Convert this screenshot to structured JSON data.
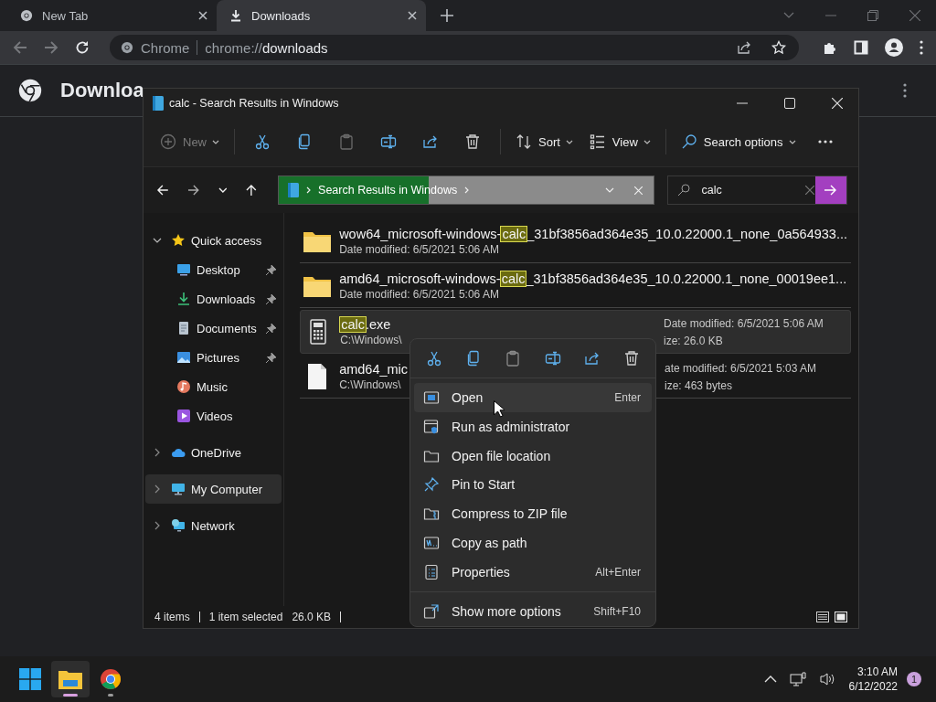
{
  "browser": {
    "tabs": [
      {
        "label": "New Tab",
        "selected": false
      },
      {
        "label": "Downloads",
        "selected": true
      }
    ],
    "omnibox": {
      "chip": "Chrome",
      "url_scheme": "chrome://",
      "url_path": "downloads"
    },
    "page": {
      "title": "Downloa"
    }
  },
  "explorer": {
    "title": "calc - Search Results in Windows",
    "toolbar": [
      {
        "kind": "new",
        "label": "New",
        "disabled": true
      },
      {
        "kind": "cut",
        "disabled": false
      },
      {
        "kind": "copy",
        "disabled": false
      },
      {
        "kind": "paste",
        "disabled": true
      },
      {
        "kind": "rename",
        "disabled": false
      },
      {
        "kind": "share",
        "disabled": false
      },
      {
        "kind": "delete",
        "disabled": false
      },
      {
        "kind": "sort",
        "label": "Sort",
        "disabled": false
      },
      {
        "kind": "view",
        "label": "View",
        "disabled": false
      },
      {
        "kind": "search-options",
        "label": "Search options",
        "disabled": false
      },
      {
        "kind": "more",
        "disabled": false
      }
    ],
    "address": {
      "crumb": "Search Results in Windows",
      "level": 0.4
    },
    "search": {
      "value": "calc"
    },
    "sidebar": [
      {
        "label": "Quick access",
        "kind": "star",
        "expanded": true,
        "selected": false,
        "children": [
          {
            "label": "Desktop",
            "kind": "desktop",
            "pinned": true,
            "selected": false
          },
          {
            "label": "Downloads",
            "kind": "download",
            "pinned": true,
            "selected": false
          },
          {
            "label": "Documents",
            "kind": "document",
            "pinned": true,
            "selected": false
          },
          {
            "label": "Pictures",
            "kind": "picture",
            "pinned": true,
            "selected": false
          },
          {
            "label": "Music",
            "kind": "music",
            "pinned": false,
            "selected": false
          },
          {
            "label": "Videos",
            "kind": "video",
            "pinned": false,
            "selected": false
          }
        ]
      },
      {
        "label": "OneDrive",
        "kind": "cloud",
        "expanded": false,
        "selected": false
      },
      {
        "label": "My Computer",
        "kind": "computer",
        "expanded": false,
        "selected": true
      },
      {
        "label": "Network",
        "kind": "network",
        "expanded": false,
        "selected": false
      }
    ],
    "results": [
      {
        "kind": "folder",
        "selected": false,
        "name": [
          {
            "text": "wow64_microsoft-windows-",
            "match": false
          },
          {
            "text": "calc",
            "match": true
          },
          {
            "text": "_31bf3856ad364e35_10.0.22000.1_none_0a564933...",
            "match": false
          }
        ],
        "detail": "Date modified: 6/5/2021 5:06 AM"
      },
      {
        "kind": "folder",
        "selected": false,
        "name": [
          {
            "text": "amd64_microsoft-windows-",
            "match": false
          },
          {
            "text": "calc",
            "match": true
          },
          {
            "text": "_31bf3856ad364e35_10.0.22000.1_none_00019ee1...",
            "match": false
          }
        ],
        "detail": "Date modified: 6/5/2021 5:06 AM"
      },
      {
        "kind": "app",
        "selected": true,
        "name": [
          {
            "text": "calc",
            "match": true
          },
          {
            "text": ".exe",
            "match": false
          }
        ],
        "detail": "C:\\Windows\\",
        "side": [
          "Date modified: 6/5/2021 5:06 AM",
          "ize: 26.0 KB"
        ]
      },
      {
        "kind": "file",
        "selected": false,
        "name": [
          {
            "text": "amd64_mic",
            "match": false
          }
        ],
        "detail": "C:\\Windows\\",
        "side": [
          "ate modified: 6/5/2021 5:03 AM",
          "ize: 463 bytes"
        ]
      }
    ],
    "status": {
      "count": "4 items",
      "selection": "1 item selected",
      "size": "26.0 KB"
    }
  },
  "context_menu": {
    "actions": [
      {
        "kind": "cut"
      },
      {
        "kind": "copy"
      },
      {
        "kind": "paste"
      },
      {
        "kind": "rename"
      },
      {
        "kind": "share"
      },
      {
        "kind": "delete"
      }
    ],
    "items": [
      {
        "kind": "open",
        "label": "Open",
        "shortcut": "Enter",
        "highlighted": true,
        "separated": false
      },
      {
        "kind": "admin",
        "label": "Run as administrator",
        "highlighted": false,
        "separated": false
      },
      {
        "kind": "location",
        "label": "Open file location",
        "highlighted": false,
        "separated": false
      },
      {
        "kind": "pin",
        "label": "Pin to Start",
        "highlighted": false,
        "separated": false
      },
      {
        "kind": "zip",
        "label": "Compress to ZIP file",
        "highlighted": false,
        "separated": false
      },
      {
        "kind": "path",
        "label": "Copy as path",
        "highlighted": false,
        "separated": false
      },
      {
        "kind": "properties",
        "label": "Properties",
        "shortcut": "Alt+Enter",
        "highlighted": false,
        "separated": false
      },
      {
        "kind": "more",
        "label": "Show more options",
        "shortcut": "Shift+F10",
        "highlighted": false,
        "separated": true
      }
    ]
  },
  "taskbar": {
    "apps": [
      {
        "kind": "start",
        "active": false,
        "running": false
      },
      {
        "kind": "explorer",
        "active": true,
        "running": true
      },
      {
        "kind": "chrome",
        "active": false,
        "running": true
      }
    ],
    "clock": {
      "time": "3:10 AM",
      "date": "6/12/2022"
    },
    "notifications": "1"
  }
}
